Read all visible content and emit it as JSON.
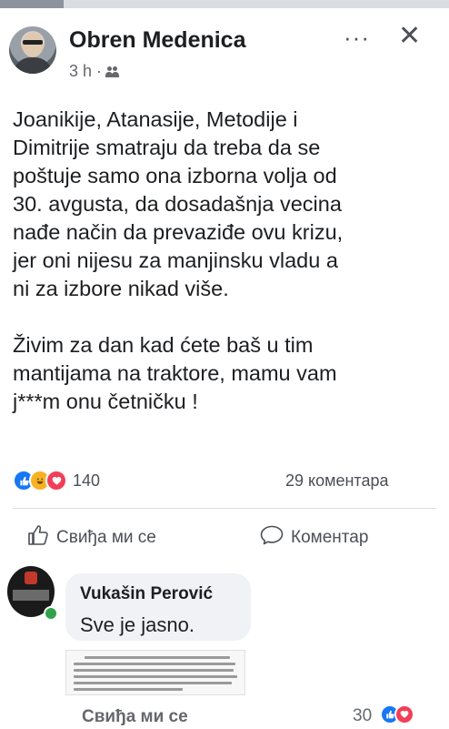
{
  "post": {
    "author": "Obren Medenica",
    "time": "3 h ·",
    "audience_icon": "friends-icon",
    "text": "Joanikije, Atanasije, Metodije i\nDimitrije smatraju da treba da se\npoštuje samo ona izborna volja od\n30. avgusta, da dosadašnja vecina\nnađe način da prevaziđe ovu krizu,\njer oni nijesu za manjinsku vladu a\nni za izbore nikad više.\n\nŽivim za dan kad ćete baš u tim\nmantijama na traktore, mamu vam\nj***m onu četničku !",
    "more_label": "···",
    "close_label": "✕",
    "reaction_count": "140",
    "comment_count": "29 коментара"
  },
  "actions": {
    "like_label": "Свиђа ми се",
    "comment_label": "Коментар"
  },
  "comment": {
    "author": "Vukašin Perović",
    "text": "Sve je jasno.",
    "like_label": "Свиђа ми се",
    "reaction_count": "30"
  },
  "colors": {
    "like_blue": "#1877f2",
    "love_red": "#f33e58",
    "haha_yellow": "#f7b125",
    "online_green": "#31a24c"
  }
}
